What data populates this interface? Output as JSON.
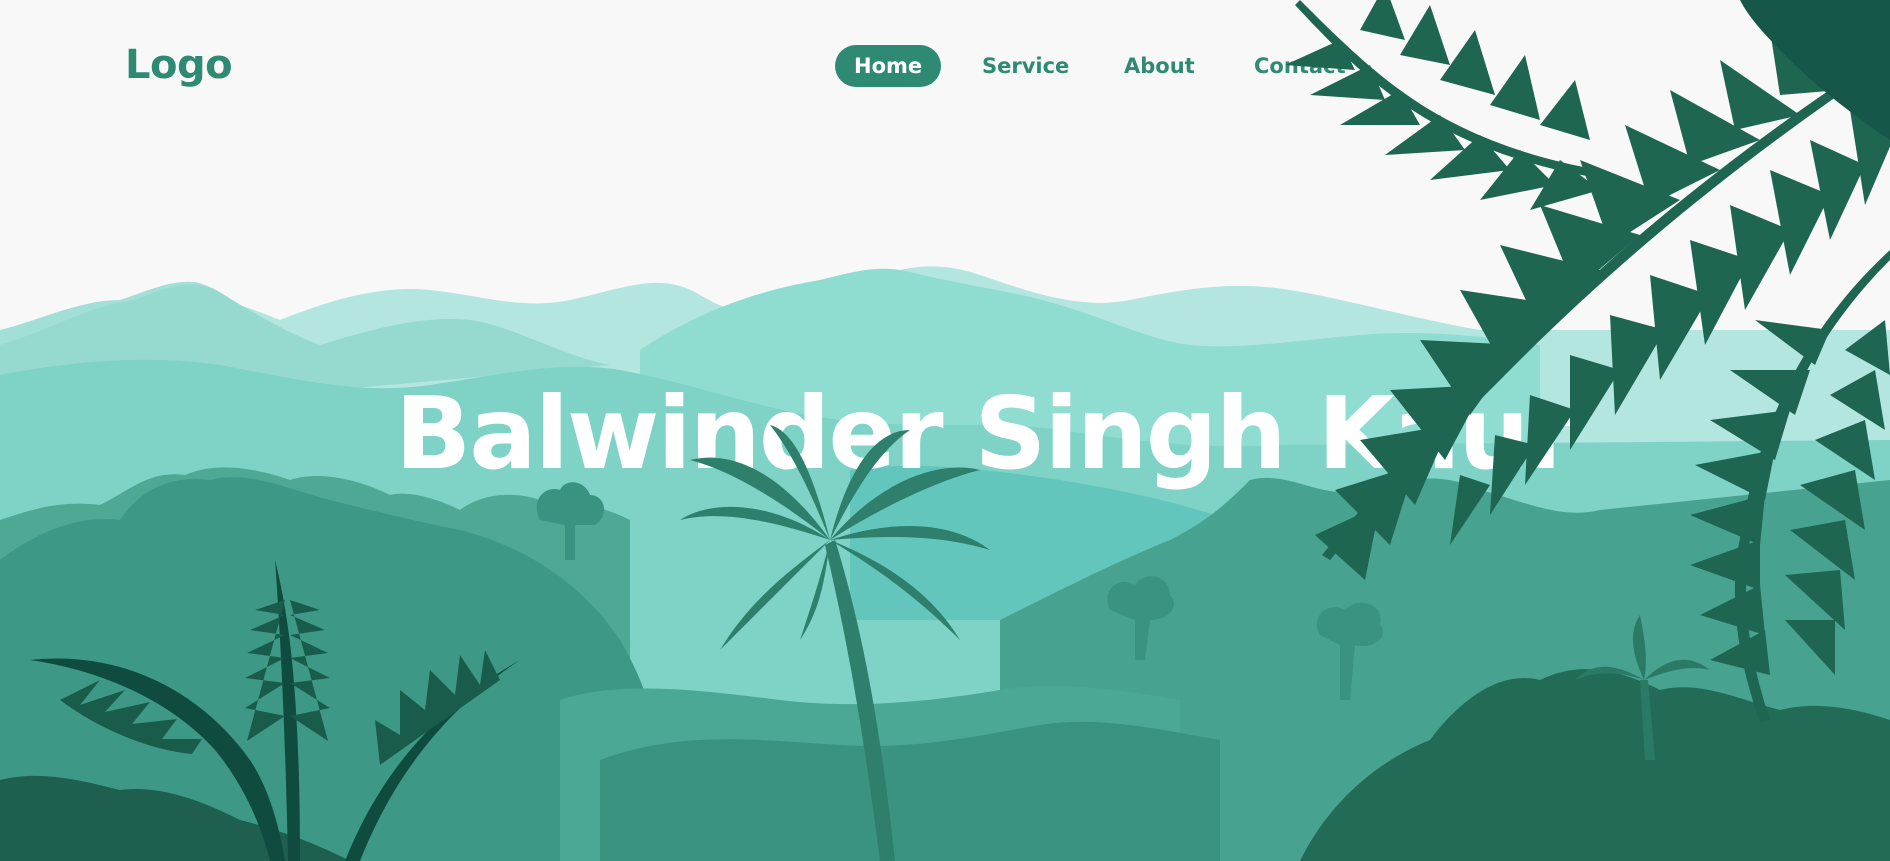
{
  "header": {
    "logo": "Logo",
    "nav": [
      {
        "label": "Home",
        "active": true
      },
      {
        "label": "Service",
        "active": false
      },
      {
        "label": "About",
        "active": false
      },
      {
        "label": "Contact",
        "active": false
      }
    ]
  },
  "hero": {
    "title": "Balwinder Singh Kaur"
  },
  "colors": {
    "accent": "#2f8a74",
    "background": "#f8f8f8",
    "mountain_far": "#b3e6df",
    "mountain_mid": "#8fdcd1",
    "forest_mid": "#5fb5a3",
    "forest_dark": "#2e7f6c",
    "fern": "#1e6552"
  },
  "illustration": {
    "scene": "jungle-landscape",
    "icons": [
      "palm-tree-icon",
      "fern-leaf-icon",
      "mountain-icon"
    ]
  }
}
